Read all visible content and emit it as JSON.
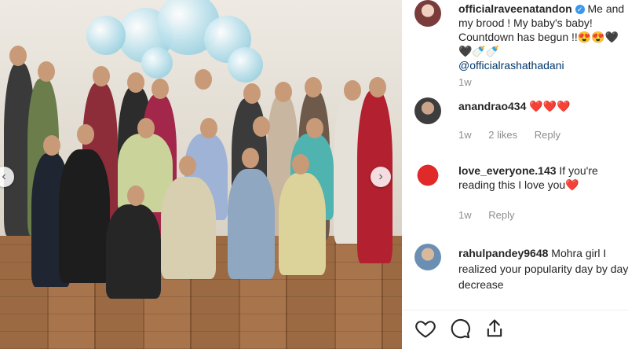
{
  "post": {
    "author_comment": {
      "user": "officialraveenatandon",
      "text": " Me and my brood ! My baby's baby! Countdown has begun !!😍😍🖤🖤🍼🍼",
      "mention": "@officialrashathadani",
      "age": "1w"
    },
    "comments": [
      {
        "user": "anandrao434",
        "text": " ❤️❤️❤️",
        "age": "1w",
        "likes": "2 likes",
        "reply": "Reply"
      },
      {
        "user": "love_everyone.143",
        "text": " If you're reading this I love you",
        "emoji": "❤️",
        "age": "1w",
        "reply": "Reply"
      },
      {
        "user": "rahulpandey9648",
        "text": " Mohra girl I realized your popularity day by day decrease"
      }
    ],
    "nav": {
      "prev": "‹",
      "next": "›"
    }
  },
  "icons": {
    "like": "heart-outline-icon",
    "comment": "comment-bubble-icon",
    "share": "share-upload-icon",
    "verified": "verified-badge-icon"
  },
  "colors": {
    "accent_blue": "#3897f0",
    "mention": "#00376b",
    "heart": "#ed4956",
    "meta": "#8e8e8e"
  }
}
